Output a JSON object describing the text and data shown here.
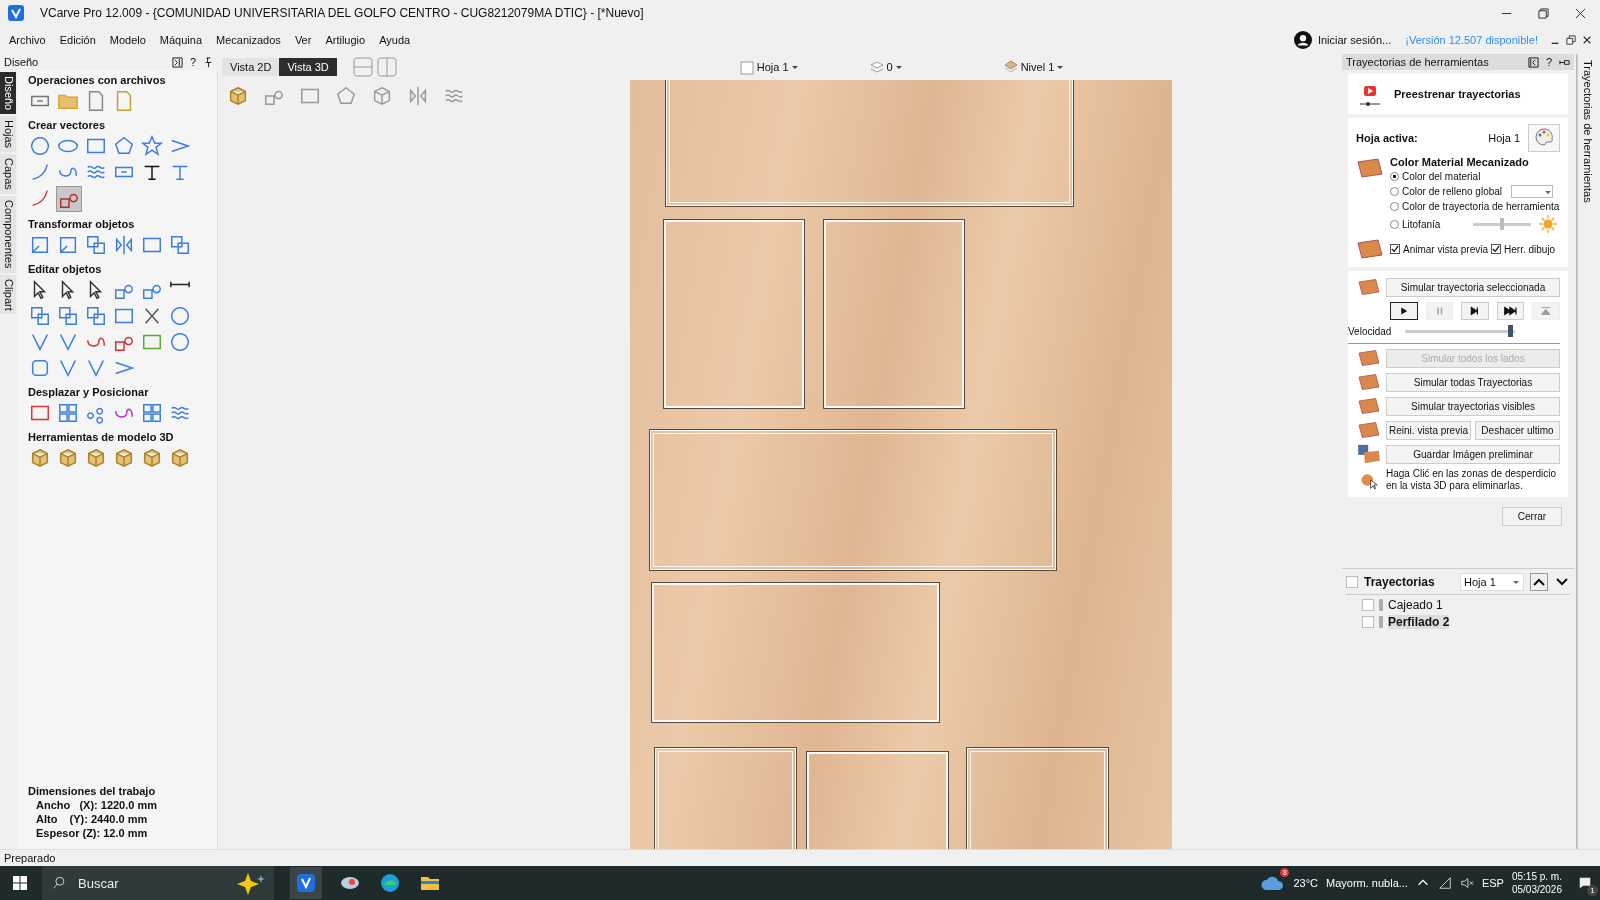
{
  "window": {
    "title": "VCarve Pro 12.009 - {COMUNIDAD UNIVERSITARIA DEL GOLFO CENTRO - CUG8212079MA DTIC} - [*Nuevo]"
  },
  "menu": [
    "Archivo",
    "Edición",
    "Modelo",
    "Máquina",
    "Mecanizados",
    "Ver",
    "Artilugio",
    "Ayuda"
  ],
  "account": {
    "label": "Iniciar sesión...",
    "update_link": "¡Versión 12.507 disponible!"
  },
  "design_panel": {
    "title": "Diseño",
    "help": "?",
    "side_tabs": [
      {
        "label": "Diseño",
        "selected": true
      },
      {
        "label": "Hojas",
        "selected": false
      },
      {
        "label": "Capas",
        "selected": false
      },
      {
        "label": "Componentes",
        "selected": false
      },
      {
        "label": "Clipart",
        "selected": false
      }
    ],
    "sections": [
      {
        "title": "Operaciones con archivos"
      },
      {
        "title": "Crear vectores"
      },
      {
        "title": "Transformar objetos"
      },
      {
        "title": "Editar objetos"
      },
      {
        "title": "Desplazar y Posicionar"
      },
      {
        "title": "Herramientas de modelo 3D"
      }
    ],
    "job": {
      "title": "Dimensiones del trabajo",
      "lines": [
        "Ancho   (X): 1220.0 mm",
        "Alto    (Y): 2440.0 mm",
        "Espesor (Z): 12.0 mm"
      ]
    }
  },
  "view_tabs": [
    {
      "label": "Vista 2D",
      "selected": false
    },
    {
      "label": "Vista 3D",
      "selected": true
    }
  ],
  "view_bar": {
    "sheet": "Hoja 1",
    "layer_count": "0",
    "level": "Nivel 1"
  },
  "toolpaths_panel": {
    "title": "Trayectorias de herramientas",
    "help": "?",
    "side_tab": "Trayectorias de herramientas",
    "preview_title": "Preestrenar trayectorias",
    "active_sheet_label": "Hoja activa:",
    "active_sheet": "Hoja 1",
    "material_title": "Color Material Mecanizado",
    "color_options": [
      {
        "label": "Color del material",
        "selected": true
      },
      {
        "label": "Color de relleno global",
        "selected": false
      },
      {
        "label": "Color de trayectoria de herramienta",
        "selected": false
      },
      {
        "label": "Litofanía",
        "selected": false
      }
    ],
    "lithophane": {
      "level": 0.5
    },
    "checkboxes": [
      {
        "label": "Animar vista previa",
        "checked": true
      },
      {
        "label": "Herr. dibujo",
        "checked": true
      }
    ],
    "simulate_selected": "Simular trayectoria seleccionada",
    "speed": {
      "label": "Velocidad",
      "level": 0.98
    },
    "actions": [
      {
        "label": "Simular todos los lados",
        "disabled": true
      },
      {
        "label": "Simular todas Trayectorias",
        "disabled": false
      },
      {
        "label": "Simular trayectorias visibles",
        "disabled": false
      }
    ],
    "pair_buttons": [
      "Reini. vista previa",
      "Deshacer ultimo"
    ],
    "save_button": "Guardar Imágen preliminar",
    "hint": "Haga Clić en las zonas de desperdicio en la vista 3D para eliminarlas.",
    "close": "Cerrar",
    "list_title": "Trayectorias",
    "list_checked": false,
    "list_sheet": "Hoja 1",
    "items": [
      {
        "name": "Cajeado 1",
        "checked": false,
        "selected": false
      },
      {
        "name": "Perfilado 2",
        "checked": false,
        "selected": true
      }
    ]
  },
  "status_bar": "Preparado",
  "taskbar": {
    "search_placeholder": "Buscar",
    "weather_badge": "8",
    "temperature": "23°C",
    "weather": "Mayorm. nubla...",
    "language": "ESP",
    "time": "05:15 p. m.",
    "date": "05/03/2026",
    "notifications": "1"
  }
}
